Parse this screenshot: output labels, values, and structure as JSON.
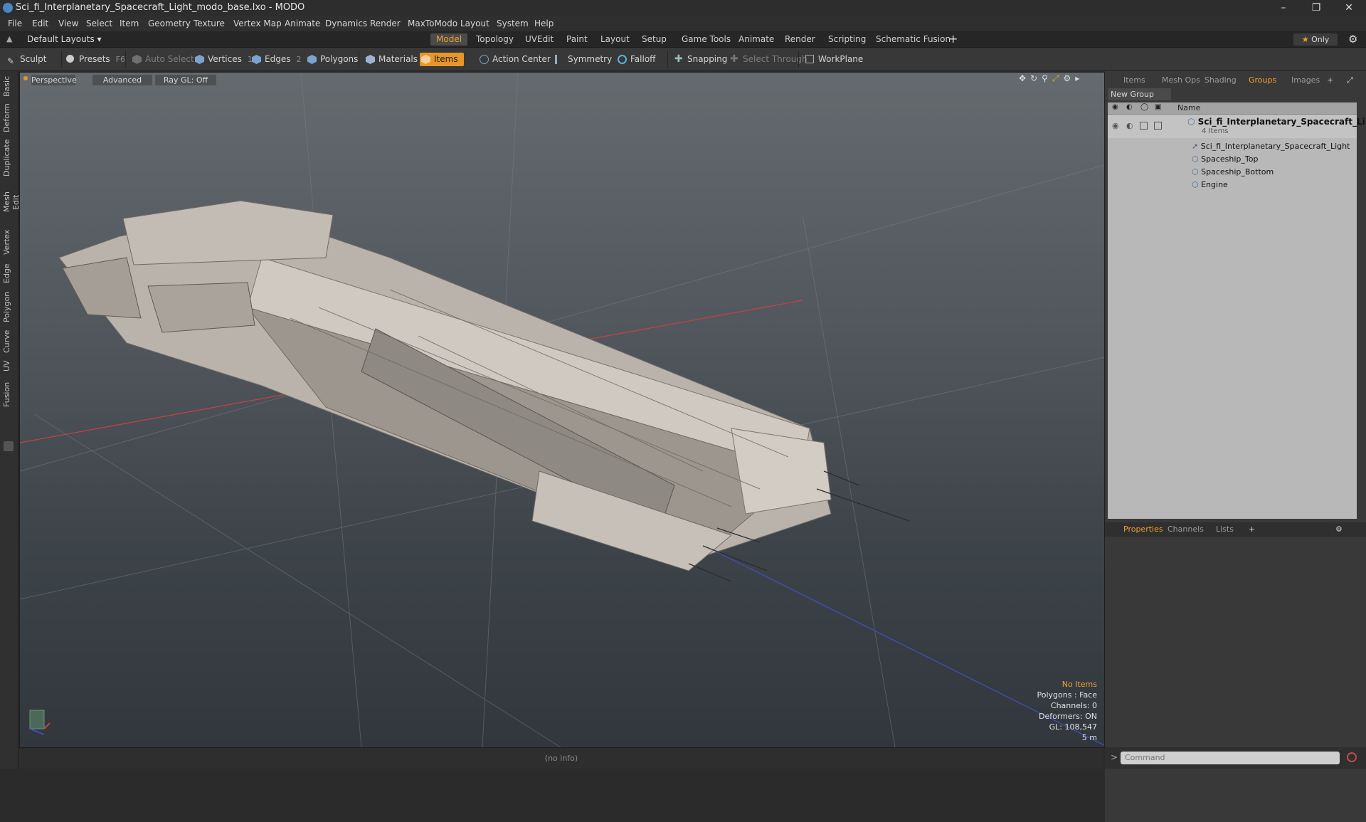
{
  "window": {
    "title": "Sci_fi_Interplanetary_Spacecraft_Light_modo_base.lxo - MODO"
  },
  "menu": [
    "File",
    "Edit",
    "View",
    "Select",
    "Item",
    "Geometry",
    "Texture",
    "Vertex Map",
    "Animate",
    "Dynamics",
    "Render",
    "MaxToModo",
    "Layout",
    "System",
    "Help"
  ],
  "layout_selector": "Default Layouts",
  "layout_tabs": [
    "Model",
    "Topology",
    "UVEdit",
    "Paint",
    "Layout",
    "Setup",
    "Game Tools",
    "Animate",
    "Render",
    "Scripting",
    "Schematic Fusion"
  ],
  "active_layout_tab": "Model",
  "only_label": "Only",
  "toolbar": {
    "sculpt": "Sculpt",
    "presets": "Presets",
    "presets_key": "F6",
    "auto_select": "Auto Select",
    "vertices": "Vertices",
    "vertices_key": "1",
    "edges": "Edges",
    "edges_key": "2",
    "polygons": "Polygons",
    "materials": "Materials",
    "items": "Items",
    "action_center": "Action Center",
    "symmetry": "Symmetry",
    "falloff": "Falloff",
    "snapping": "Snapping",
    "select_through": "Select Through",
    "workplane": "WorkPlane"
  },
  "left_tabs": [
    "Basic",
    "Deform",
    "Duplicate",
    "Mesh Edit",
    "Vertex",
    "Edge",
    "Polygon",
    "Curve",
    "UV",
    "Fusion"
  ],
  "viewport": {
    "view_mode": "Perspective",
    "shading": "Advanced",
    "raygl": "Ray GL: Off",
    "hud": {
      "selection": "No Items",
      "polygons": "Polygons : Face",
      "channels": "Channels: 0",
      "deformers": "Deformers: ON",
      "gl": "GL: 108,547",
      "scale": "5 m"
    }
  },
  "status": "(no info)",
  "right_panel": {
    "tabs": [
      "Items",
      "Mesh Ops",
      "Shading",
      "Groups",
      "Images"
    ],
    "active_tab": "Groups",
    "new_group": "New Group",
    "column_name": "Name",
    "group_name": "Sci_fi_Interplanetary_Spacecraft_Li...",
    "group_count": "4 Items",
    "items": [
      "Sci_fi_Interplanetary_Spacecraft_Light",
      "Spaceship_Top",
      "Spaceship_Bottom",
      "Engine"
    ],
    "bottom_tabs": [
      "Properties",
      "Channels",
      "Lists"
    ],
    "active_bottom_tab": "Properties",
    "command_placeholder": "Command"
  },
  "colors": {
    "accent": "#f0a030",
    "active_tool": "#e8962a",
    "axis_x": "#c94040",
    "axis_z": "#4050c0"
  }
}
